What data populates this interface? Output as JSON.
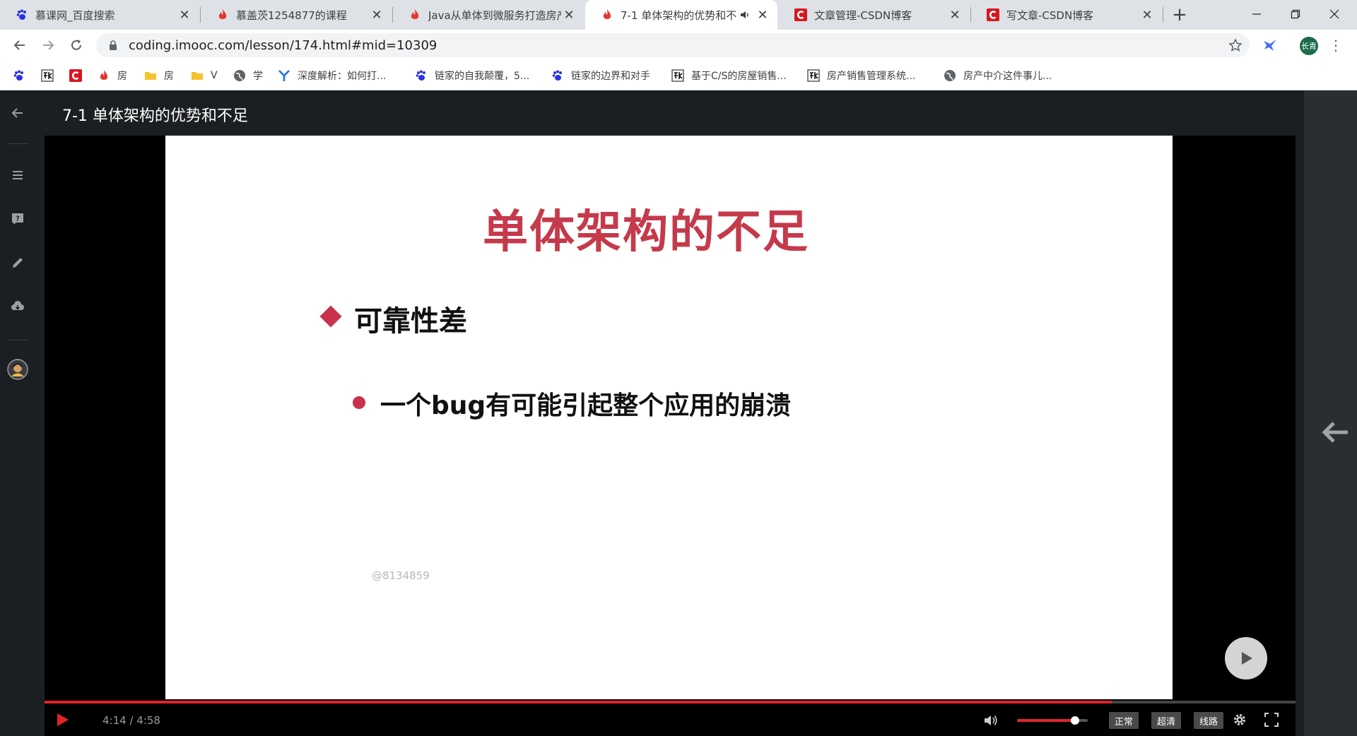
{
  "browser": {
    "tabs": [
      {
        "title": "慕课网_百度搜索",
        "favicon": "baidu-paw",
        "active": false
      },
      {
        "title": "慕盖茨1254877的课程",
        "favicon": "imooc-flame",
        "active": false
      },
      {
        "title": "Java从单体到微服务打造房产",
        "favicon": "imooc-flame",
        "active": false
      },
      {
        "title": "7-1 单体架构的优势和不",
        "favicon": "imooc-flame",
        "active": true,
        "playing_audio": true
      },
      {
        "title": "文章管理-CSDN博客",
        "favicon": "csdn-c",
        "active": false
      },
      {
        "title": "写文章-CSDN博客",
        "favicon": "csdn-c",
        "active": false
      }
    ],
    "close_glyph": "✕",
    "new_tab_glyph": "+",
    "url": "coding.imooc.com/lesson/174.html#mid=10309",
    "profile_label": "长青",
    "menu_glyph": "⋮",
    "bookmarks": [
      {
        "label": "",
        "icon": "baidu-paw"
      },
      {
        "label": "",
        "icon": "zhi-logo"
      },
      {
        "label": "",
        "icon": "csdn-c"
      },
      {
        "label": "房",
        "icon": "imooc-flame"
      },
      {
        "label": "房",
        "icon": "folder"
      },
      {
        "label": "V",
        "icon": "folder"
      },
      {
        "label": "学",
        "icon": "globe"
      },
      {
        "label": "深度解析：如何打...",
        "icon": "y-logo"
      },
      {
        "label": "链家的自我颠覆，5...",
        "icon": "baidu-paw"
      },
      {
        "label": "链家的边界和对手",
        "icon": "baidu-paw"
      },
      {
        "label": "基于C/S的房屋销售...",
        "icon": "zhi-logo"
      },
      {
        "label": "房产销售管理系统...",
        "icon": "zhi-logo"
      },
      {
        "label": "房产中介这件事儿...",
        "icon": "globe"
      }
    ]
  },
  "lesson": {
    "title": "7-1 单体架构的优势和不足"
  },
  "slide": {
    "title": "单体架构的不足",
    "bullet1": "可靠性差",
    "bullet2": "一个bug有可能引起整个应用的崩溃",
    "watermark": "@8134859"
  },
  "player": {
    "time": "4:14 / 4:58",
    "progress": 0.853,
    "volume": 0.82,
    "speed_label": "正常",
    "quality_label": "超清",
    "route_label": "线路"
  },
  "colors": {
    "accent": "#e0242b",
    "slide_title": "#c53a4b",
    "bullet": "#c8324a"
  }
}
